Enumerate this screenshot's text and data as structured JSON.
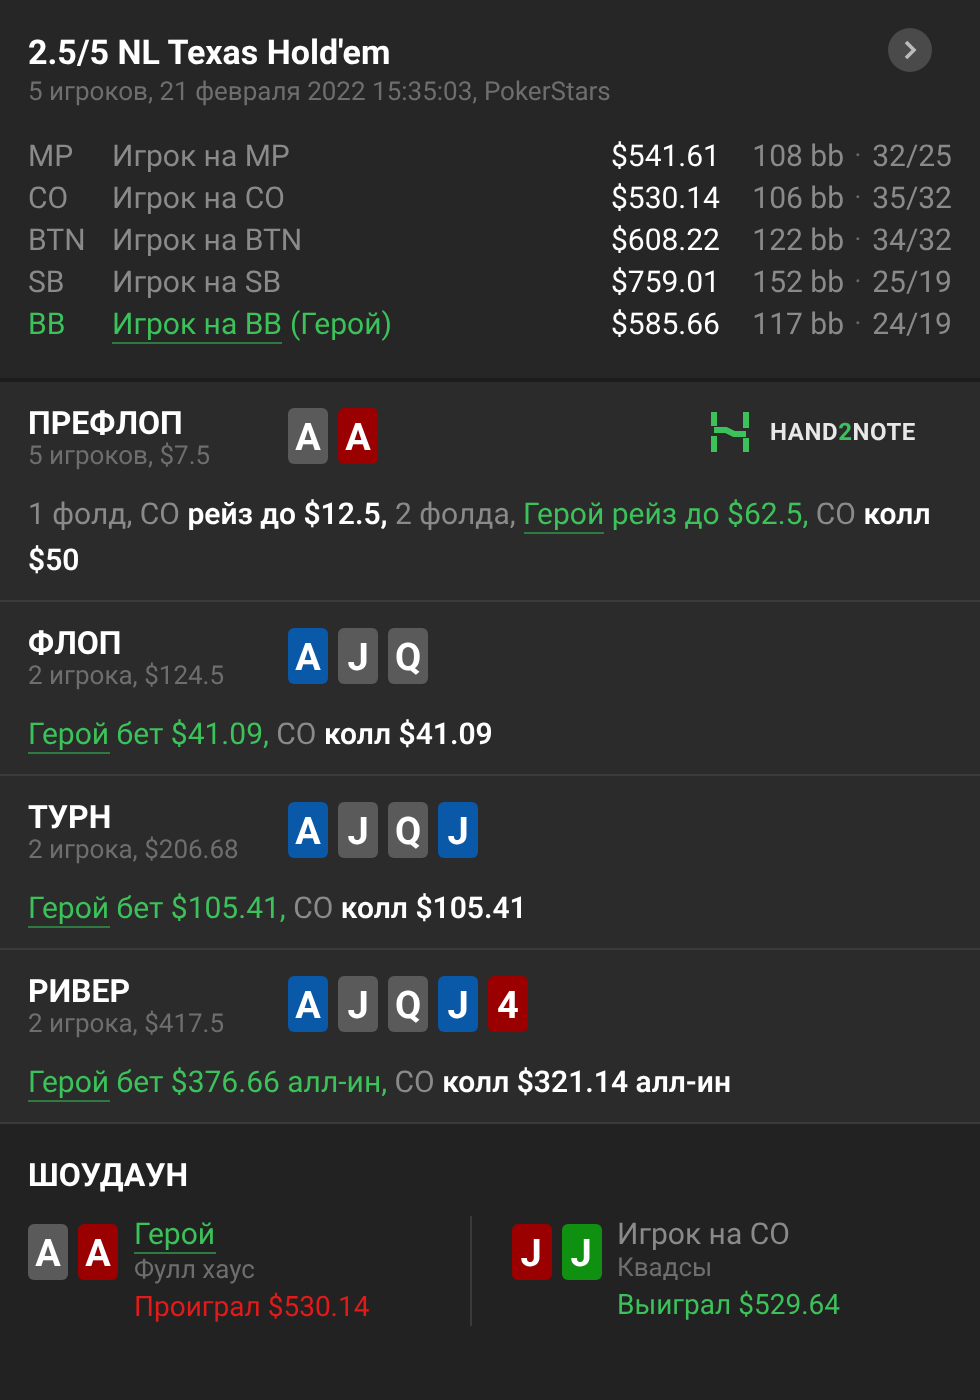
{
  "header": {
    "title": "2.5/5 NL Texas Hold'em",
    "subtitle": "5 игроков, 21 февраля 2022 15:35:03, PokerStars"
  },
  "players": [
    {
      "position": "MP",
      "name": "Игрок на MP",
      "hero": false,
      "stack": "$541.61",
      "bb": "108 bb",
      "separator": "·",
      "stats": "32/25"
    },
    {
      "position": "CO",
      "name": "Игрок на CO",
      "hero": false,
      "stack": "$530.14",
      "bb": "106 bb",
      "separator": "·",
      "stats": "35/32"
    },
    {
      "position": "BTN",
      "name": "Игрок на BTN",
      "hero": false,
      "stack": "$608.22",
      "bb": "122 bb",
      "separator": "·",
      "stats": "34/32"
    },
    {
      "position": "SB",
      "name": "Игрок на SB",
      "hero": false,
      "stack": "$759.01",
      "bb": "152 bb",
      "separator": "·",
      "stats": "25/19"
    },
    {
      "position": "BB",
      "name": "Игрок на BB",
      "hero": true,
      "hero_suffix": "(Герой)",
      "stack": "$585.66",
      "bb": "117 bb",
      "separator": "·",
      "stats": "24/19"
    }
  ],
  "logo": {
    "parts": [
      "HAND",
      "2",
      "NOTE"
    ]
  },
  "streets": [
    {
      "name": "ПРЕФЛОП",
      "info": "5 игроков, $7.5",
      "cards": [
        {
          "rank": "A",
          "color": "#5a5a5a"
        },
        {
          "rank": "A",
          "color": "#9b0000"
        }
      ],
      "actions": [
        {
          "kind": "muted",
          "text": "1 фолд, CO "
        },
        {
          "kind": "action",
          "text": "рейз до $12.5,"
        },
        {
          "kind": "muted",
          "text": " 2 фолда, "
        },
        {
          "kind": "hero",
          "text": "Герой"
        },
        {
          "kind": "hero_action",
          "text": " рейз до $62.5,"
        },
        {
          "kind": "muted",
          "text": " CO "
        },
        {
          "kind": "action",
          "text": "колл $50"
        }
      ]
    },
    {
      "name": "ФЛОП",
      "info": "2 игрока, $124.5",
      "cards": [
        {
          "rank": "A",
          "color": "#0a58a8"
        },
        {
          "rank": "J",
          "color": "#5a5a5a"
        },
        {
          "rank": "Q",
          "color": "#5a5a5a"
        }
      ],
      "actions": [
        {
          "kind": "hero",
          "text": "Герой"
        },
        {
          "kind": "hero_action",
          "text": " бет $41.09,"
        },
        {
          "kind": "muted",
          "text": " CO "
        },
        {
          "kind": "action",
          "text": "колл $41.09"
        }
      ]
    },
    {
      "name": "ТУРН",
      "info": "2 игрока, $206.68",
      "cards": [
        {
          "rank": "A",
          "color": "#0a58a8"
        },
        {
          "rank": "J",
          "color": "#5a5a5a"
        },
        {
          "rank": "Q",
          "color": "#5a5a5a"
        },
        {
          "rank": "J",
          "color": "#0a58a8"
        }
      ],
      "actions": [
        {
          "kind": "hero",
          "text": "Герой"
        },
        {
          "kind": "hero_action",
          "text": " бет $105.41,"
        },
        {
          "kind": "muted",
          "text": " CO "
        },
        {
          "kind": "action",
          "text": "колл $105.41"
        }
      ]
    },
    {
      "name": "РИВЕР",
      "info": "2 игрока, $417.5",
      "cards": [
        {
          "rank": "A",
          "color": "#0a58a8"
        },
        {
          "rank": "J",
          "color": "#5a5a5a"
        },
        {
          "rank": "Q",
          "color": "#5a5a5a"
        },
        {
          "rank": "J",
          "color": "#0a58a8"
        },
        {
          "rank": "4",
          "color": "#9b0000"
        }
      ],
      "actions": [
        {
          "kind": "hero",
          "text": "Герой"
        },
        {
          "kind": "hero_action",
          "text": " бет $376.66 алл-ин,"
        },
        {
          "kind": "muted",
          "text": " CO "
        },
        {
          "kind": "action",
          "text": "колл $321.14 алл-ин"
        }
      ]
    }
  ],
  "showdown": {
    "title": "ШОУДАУН",
    "players": [
      {
        "name": "Герой",
        "hero": true,
        "cards": [
          {
            "rank": "A",
            "color": "#5a5a5a"
          },
          {
            "rank": "A",
            "color": "#9b0000"
          }
        ],
        "combo": "Фулл хаус",
        "result": "Проиграл $530.14",
        "won": false
      },
      {
        "name": "Игрок на CO",
        "hero": false,
        "cards": [
          {
            "rank": "J",
            "color": "#9b0000"
          },
          {
            "rank": "J",
            "color": "#109010"
          }
        ],
        "combo": "Квадсы",
        "result": "Выиграл $529.64",
        "won": true
      }
    ]
  }
}
